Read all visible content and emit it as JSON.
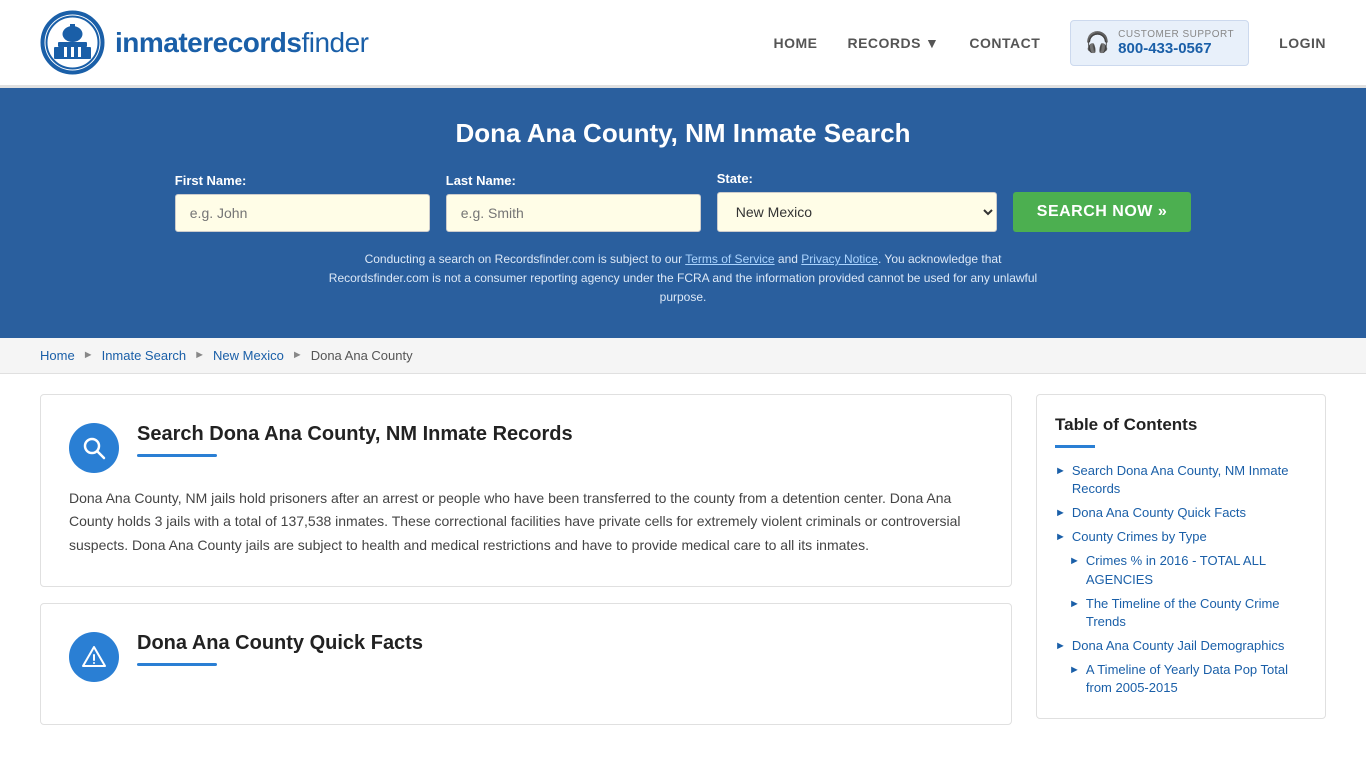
{
  "header": {
    "logo_text_regular": "inmaterecords",
    "logo_text_bold": "finder",
    "nav": {
      "home": "HOME",
      "records": "RECORDS",
      "contact": "CONTACT",
      "support_label": "CUSTOMER SUPPORT",
      "support_number": "800-433-0567",
      "login": "LOGIN"
    }
  },
  "hero": {
    "title": "Dona Ana County, NM Inmate Search",
    "form": {
      "first_name_label": "First Name:",
      "first_name_placeholder": "e.g. John",
      "last_name_label": "Last Name:",
      "last_name_placeholder": "e.g. Smith",
      "state_label": "State:",
      "state_value": "New Mexico",
      "search_button": "SEARCH NOW »",
      "disclaimer": "Conducting a search on Recordsfinder.com is subject to our Terms of Service and Privacy Notice. You acknowledge that Recordsfinder.com is not a consumer reporting agency under the FCRA and the information provided cannot be used for any unlawful purpose.",
      "tos_link": "Terms of Service",
      "privacy_link": "Privacy Notice"
    }
  },
  "breadcrumb": {
    "items": [
      "Home",
      "Inmate Search",
      "New Mexico",
      "Dona Ana County"
    ]
  },
  "main": {
    "cards": [
      {
        "id": "inmate-records",
        "icon": "search",
        "title": "Search Dona Ana County, NM Inmate Records",
        "body": "Dona Ana County, NM jails hold prisoners after an arrest or people who have been transferred to the county from a detention center. Dona Ana County holds 3 jails with a total of 137,538 inmates. These correctional facilities have private cells for extremely violent criminals or controversial suspects. Dona Ana County jails are subject to health and medical restrictions and have to provide medical care to all its inmates."
      },
      {
        "id": "quick-facts",
        "icon": "warning",
        "title": "Dona Ana County Quick Facts",
        "body": ""
      }
    ]
  },
  "sidebar": {
    "toc_title": "Table of Contents",
    "items": [
      {
        "label": "Search Dona Ana County, NM Inmate Records",
        "sub": false
      },
      {
        "label": "Dona Ana County Quick Facts",
        "sub": false
      },
      {
        "label": "County Crimes by Type",
        "sub": false
      },
      {
        "label": "Crimes % in 2016 - TOTAL ALL AGENCIES",
        "sub": true
      },
      {
        "label": "The Timeline of the County Crime Trends",
        "sub": true
      },
      {
        "label": "Dona Ana County Jail Demographics",
        "sub": false
      },
      {
        "label": "A Timeline of Yearly Data Pop Total from 2005-2015",
        "sub": true
      }
    ]
  }
}
